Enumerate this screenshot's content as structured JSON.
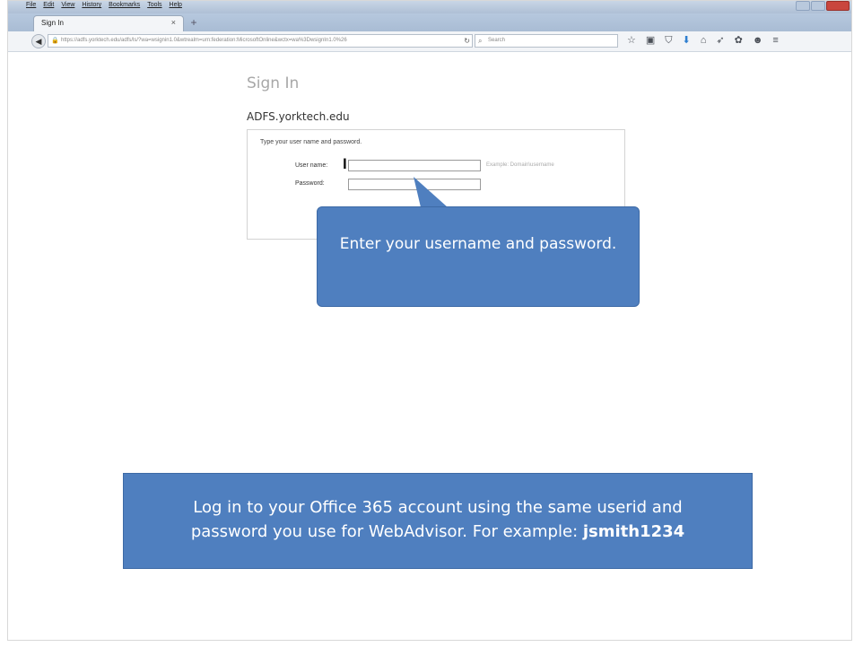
{
  "browser": {
    "menu": [
      "File",
      "Edit",
      "View",
      "History",
      "Bookmarks",
      "Tools",
      "Help"
    ],
    "tab_title": "Sign In",
    "tab_close": "×",
    "new_tab": "+",
    "url": "https://adfs.yorktech.edu/adfs/ls/?wa=wsignin1.0&wtrealm=urn:federation:MicrosoftOnline&wctx=wa%3DwsignIn1.0%26",
    "search_placeholder": "Search",
    "toolbar_icons": [
      "star-icon",
      "reader-icon",
      "pocket-icon",
      "download-icon",
      "home-icon",
      "send-icon",
      "extension-icon",
      "chat-icon",
      "menu-icon"
    ]
  },
  "page": {
    "title": "Sign In",
    "realm": "ADFS.yorktech.edu",
    "instruction": "Type your user name and password.",
    "username_label": "User name:",
    "password_label": "Password:",
    "username_value": "",
    "password_value": "",
    "username_hint": "Example: Domain\\username"
  },
  "callouts": {
    "enter_credentials": "Enter your username and password.",
    "office_line1": "Log in to your Office 365 account using the same userid and",
    "office_line2": "password you use for WebAdvisor.  For example: ",
    "office_example": "jsmith1234"
  },
  "colors": {
    "callout_bg": "#4f7fbf",
    "callout_text": "#ffffff",
    "page_title": "#a8a8a8"
  }
}
